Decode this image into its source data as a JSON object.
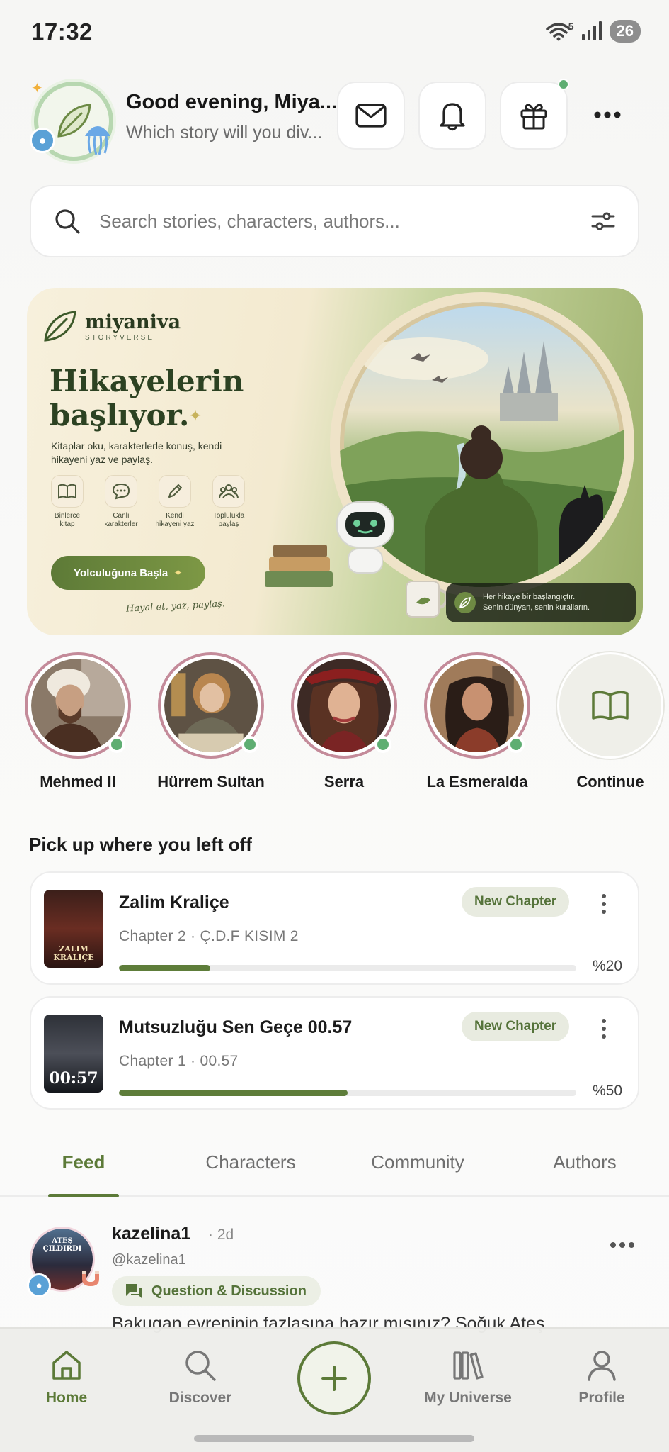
{
  "status_bar": {
    "time": "17:32",
    "network": "5",
    "battery": "26"
  },
  "header": {
    "greeting": "Good evening, Miya...",
    "subtitle": "Which story will you div..."
  },
  "search": {
    "placeholder": "Search stories, characters, authors..."
  },
  "hero": {
    "brand": "miyaniva",
    "brand_sub": "STORYVERSE",
    "title_line1": "Hikayelerin",
    "title_line2": "başlıyor.",
    "description": "Kitaplar oku, karakterlerle konuş, kendi hikayeni yaz ve paylaş.",
    "features": [
      {
        "label": "Binlerce kitap",
        "icon": "book-icon"
      },
      {
        "label": "Canlı karakterler",
        "icon": "chat-icon"
      },
      {
        "label": "Kendi hikayeni yaz",
        "icon": "pen-icon"
      },
      {
        "label": "Toplulukla paylaş",
        "icon": "people-icon"
      }
    ],
    "cta": "Yolculuğuna Başla",
    "signature": "Hayal et, yaz, paylaş.",
    "caption_line1": "Her hikaye bir başlangıçtır.",
    "caption_line2": "Senin dünyan, senin kuralların."
  },
  "characters": [
    {
      "name": "Mehmed II",
      "online": true
    },
    {
      "name": "Hürrem Sultan",
      "online": true
    },
    {
      "name": "Serra",
      "online": true
    },
    {
      "name": "La Esmeralda",
      "online": true
    },
    {
      "name": "Continue",
      "online": false
    }
  ],
  "continue_reading": {
    "title": "Pick up where you left off",
    "items": [
      {
        "title": "Zalim Kraliçe",
        "badge": "New Chapter",
        "chapter": "Chapter 2 · Ç.D.F KISIM 2",
        "progress": 0.2,
        "progress_label": "%20",
        "cover_text": "ZALIM KRALIÇE"
      },
      {
        "title": "Mutsuzluğu Sen Geçe 00.57",
        "badge": "New Chapter",
        "chapter": "Chapter 1 · 00.57",
        "progress": 0.5,
        "progress_label": "%50",
        "cover_text": "00:57"
      }
    ]
  },
  "tabs": [
    "Feed",
    "Characters",
    "Community",
    "Authors"
  ],
  "active_tab": "Feed",
  "feed_post": {
    "username": "kazelina1",
    "time": "· 2d",
    "handle": "@kazelina1",
    "avatar_text": "ATEŞ ÇILDIRDI",
    "tag": "Question & Discussion",
    "text": "Bakugan evreninin fazlasına hazır mısınız? Soğuk Ateş..."
  },
  "bottom_nav": {
    "items": [
      {
        "label": "Home",
        "icon": "home-icon",
        "active": true
      },
      {
        "label": "Discover",
        "icon": "search-icon",
        "active": false
      },
      {
        "label": "My Universe",
        "icon": "library-icon",
        "active": false
      },
      {
        "label": "Profile",
        "icon": "user-icon",
        "active": false
      }
    ],
    "add_icon": "plus-icon"
  },
  "colors": {
    "accent": "#5c7a38",
    "online": "#5fae72",
    "ring": "#c48b9a"
  }
}
